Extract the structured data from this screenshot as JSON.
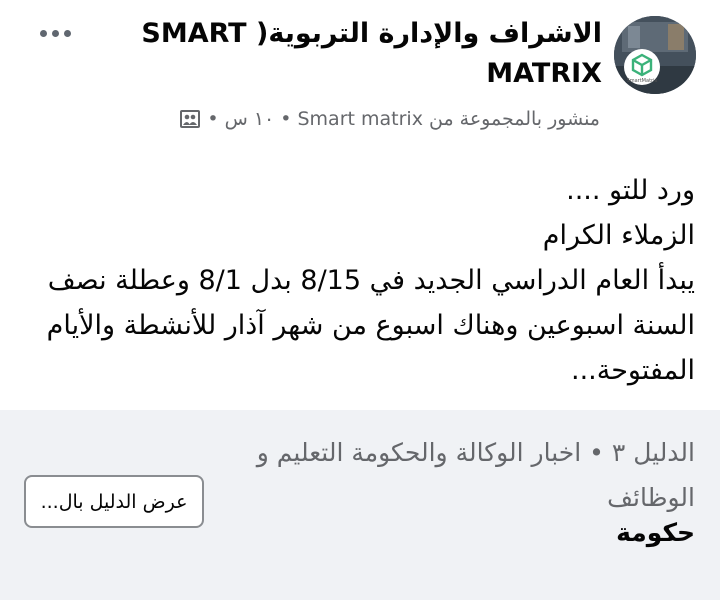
{
  "header": {
    "group_name": "الاشراف والإدارة  التربوية( SMART MATRIX",
    "meta": {
      "posted_in": "منشور بالمجموعة من Smart matrix",
      "time": "١٠ س"
    },
    "avatar_caption": "SmartMatrix"
  },
  "post": {
    "lines": [
      "ورد للتو ....",
      "الزملاء الكرام",
      "يبدأ العام الدراسي الجديد في 8/15 بدل 8/1 وعطلة نصف",
      "السنة اسبوعين وهناك اسبوع من شهر آذار للأنشطة والأيام",
      "المفتوحة..."
    ]
  },
  "guide_preview": {
    "title": "الدليل ٣ • اخبار الوكالة والحكومة التعليم و الوظائف",
    "subtitle": "حكومة",
    "button_label": "عرض الدليل بال..."
  },
  "colors": {
    "primary_text": "#050505",
    "secondary_text": "#65676b",
    "preview_bg": "#f0f2f5",
    "logo_green": "#3bb27a"
  }
}
